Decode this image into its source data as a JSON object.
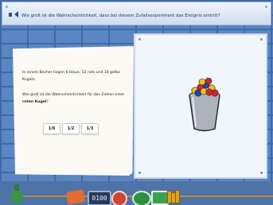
{
  "header": {
    "question": "Wie groß ist die Wahrscheinlichkeit, dass bei diesem Zufallsexperiment das Ereignis eintritt?"
  },
  "task": {
    "paragraph1": "In einem Becher liegen 6 blaue, 12 rote und 18 gelbe Kugeln.",
    "paragraph2_pre": "Wie groß ist die Wahrscheinlichkeit für das Ziehen einer ",
    "paragraph2_bold": "roten Kugel",
    "paragraph2_post": "?",
    "options": [
      "1/6",
      "1/2",
      "1/3"
    ]
  },
  "toolbar": {
    "display_value": "0100"
  },
  "colors": {
    "wall": "#5b86c4",
    "paper": "#fbf9f3",
    "board": "#f1f5fc",
    "ball_red": "#d6242b",
    "ball_blue": "#2244b8",
    "ball_yellow": "#f2c21a"
  },
  "icons": {
    "sound": "speaker-icon",
    "cup": "cup-with-balls-icon",
    "vase": "vase-icon",
    "help": "help-icon",
    "forward": "forward-arrow-icon",
    "monitor": "monitor-icon",
    "books": "books-icon"
  }
}
